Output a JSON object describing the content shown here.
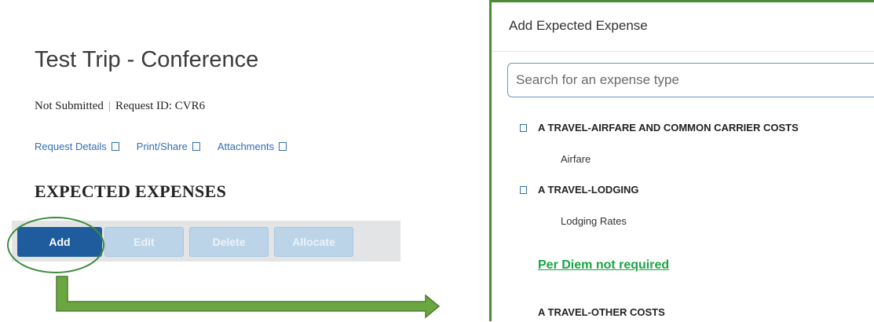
{
  "trip": {
    "title": "Test Trip - Conference",
    "status": "Not Submitted",
    "separator": "|",
    "request_id": "Request ID: CVR6"
  },
  "links": [
    {
      "label": "Request Details",
      "icon": "square-icon"
    },
    {
      "label": "Print/Share",
      "icon": "square-icon"
    },
    {
      "label": "Attachments",
      "icon": "square-icon"
    }
  ],
  "section": {
    "heading": "EXPECTED EXPENSES"
  },
  "toolbar": {
    "add_label": "Add",
    "edit_label": "Edit",
    "delete_label": "Delete",
    "allocate_label": "Allocate"
  },
  "dialog": {
    "title": "Add Expected Expense",
    "search_placeholder": "Search for an expense type",
    "categories": [
      {
        "label": "A TRAVEL-AIRFARE AND COMMON CARRIER COSTS",
        "items": [
          "Airfare"
        ]
      },
      {
        "label": "A TRAVEL-LODGING",
        "items": [
          "Lodging Rates"
        ]
      }
    ],
    "note": "Per Diem not required",
    "next_category": "A TRAVEL-OTHER COSTS"
  },
  "colors": {
    "primary_button": "#1f5c9e",
    "disabled_button": "#bcd4e8",
    "annotation_green": "#4c8a36",
    "note_green": "#1aa545",
    "link_blue": "#2f6fb4"
  }
}
